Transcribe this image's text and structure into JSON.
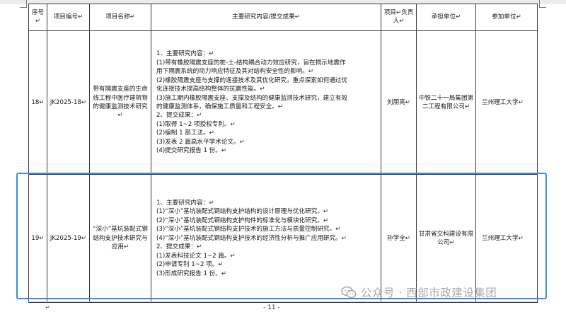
{
  "table": {
    "headers": [
      "序号↵",
      "项目编号↵",
      "项目名称↵",
      "主要研究内容/提交成果↵",
      "项目↵负责人↵",
      "承担单位↵",
      "参加单位↵"
    ],
    "rows": [
      {
        "no": "18↵",
        "code": "JK2025-18↵",
        "name": "带有隔震支座的生命线工程中医疗建筑物的健康监测技术研究↵",
        "content": [
          "1、主要研究内容：↵",
          "(1)带有橡胶隔震支座的桩-土-结构耦合动力效应研究，旨在揭示地震作",
          "用下隔震系统的动力响应特征及其对结构安全性的影响。↵",
          "(2)橡胶隔震支座与支撑的连接技术及其优化研究，重点探索如何通过优",
          "化连接技术提高结构整体的抗震性能。↵",
          "(3)施工期内橡胶隔震支座、支撑及结构的健康监测技术研究，建立有效",
          "的健康监测体系，确保施工质量和工程安全。↵",
          "2、提交成果：↵",
          "(1)取得 1~2 项授权专利。↵",
          "(2)编制 1 部工法。↵",
          "(3)发表 2 篇高水平学术论文。↵",
          "(4)提交研究报告 1 份。↵"
        ],
        "leader": "刘朋亮↵",
        "unit": "中铁二十一局集团第二工程有限公司↵",
        "partner": "兰州理工大学↵"
      },
      {
        "no": "19↵",
        "code": "JK2025-19↵",
        "name": "“深小”基坑装配式钢结构支护技术研究与应用↵",
        "content": [
          "1、主要研究内容：↵",
          "(1)“深小”基坑装配式钢结构支护结构的设计原理与优化研究。↵",
          "(2)“深小”基坑装配式钢结构支护构件的标准化与模块化研究。↵",
          "(3)“深小”基坑装配式钢结构支护技术的施工方法与质量控制研究。↵",
          "(4)“深小”基坑装配式钢结构支护技术的经济性分析与推广应用研究。↵",
          "2、提交成果：↵",
          "(1)发表科技论文 1~2 篇。↵",
          "(2)申请专利 1~2 项。↵",
          "(3)形成研究报告 1 份。↵"
        ],
        "leader": "孙学全↵",
        "unit": "甘肃省交科建设有限公司↵",
        "partner": "兰州理工大学↵"
      }
    ]
  },
  "watermark": {
    "text": "公众号 · 西部市政建设集团",
    "icon": "wechat-icon"
  },
  "footer": {
    "page_number": "- 11 -",
    "mark": "↵"
  },
  "colors": {
    "highlight": "#3a8ee6",
    "border": "#3a3a3a",
    "watermark": "#a0a0a0"
  }
}
